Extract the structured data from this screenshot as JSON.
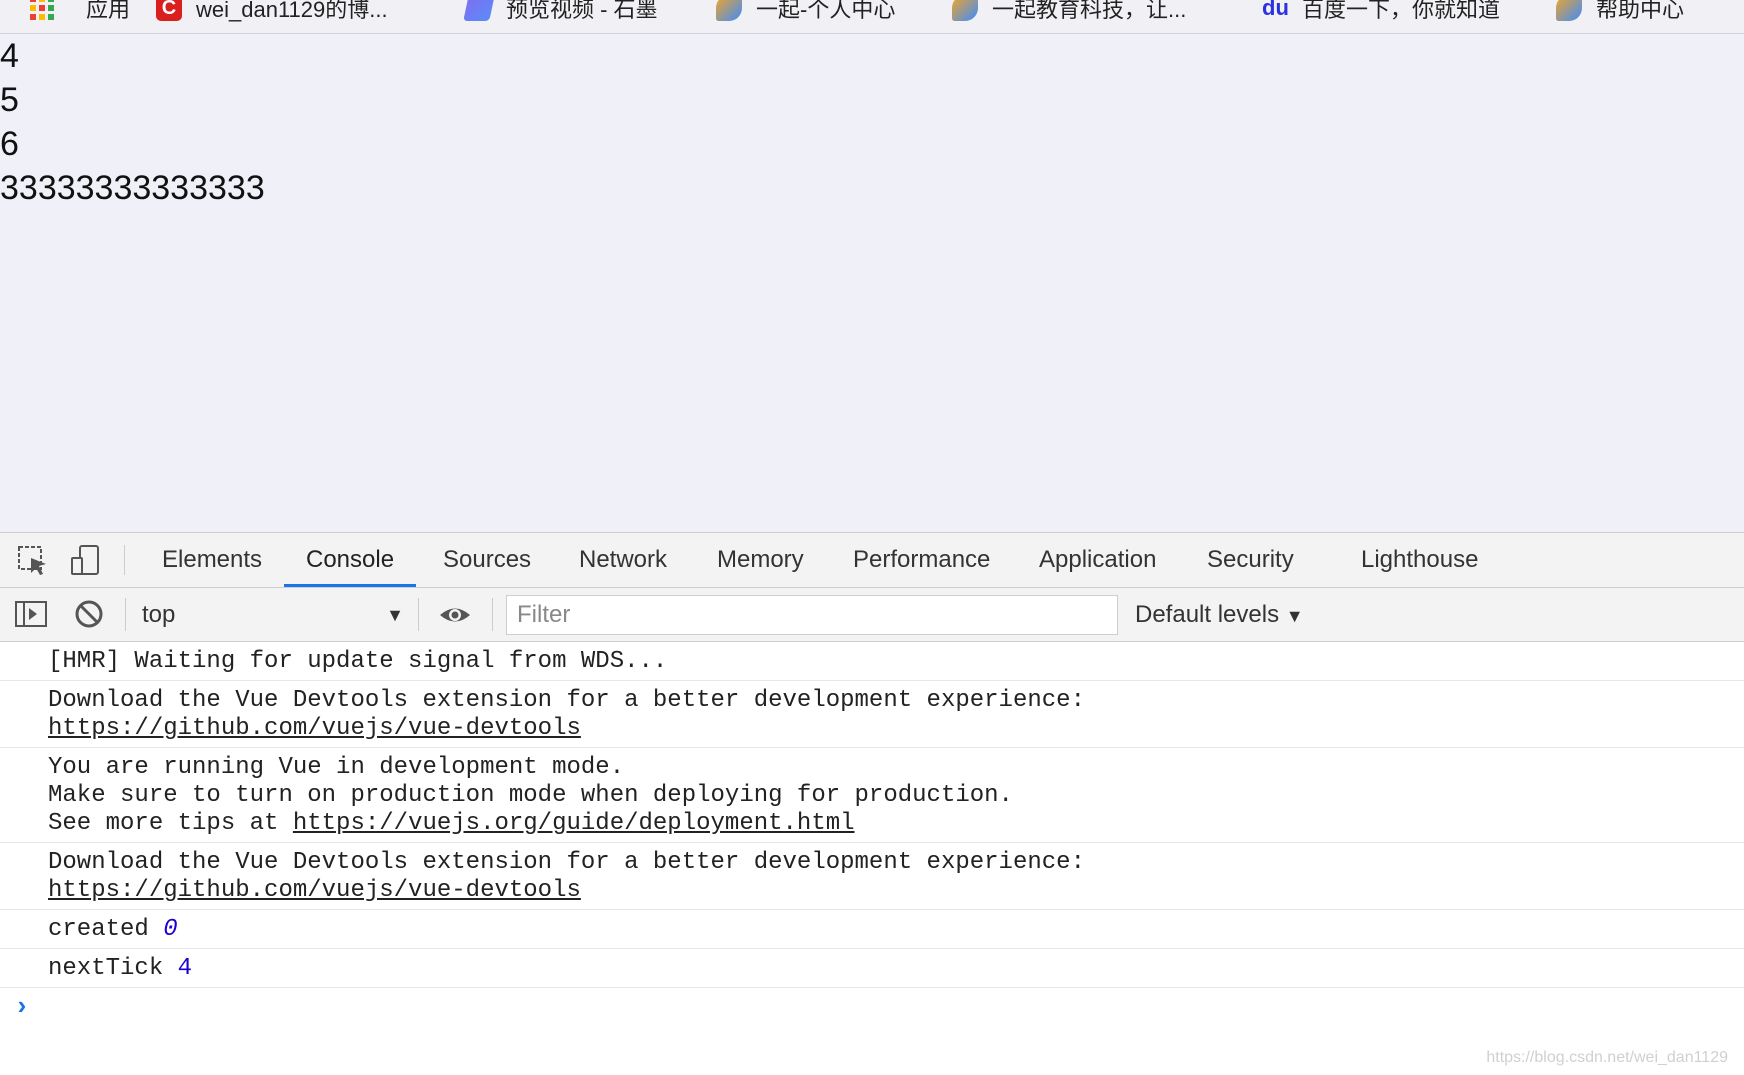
{
  "bookmarks": [
    {
      "label": "应用",
      "icon": "apps-grid-icon"
    },
    {
      "label": "wei_dan1129的博...",
      "icon": "csdn-icon"
    },
    {
      "label": "预览视频 - 石墨",
      "icon": "shimo-icon"
    },
    {
      "label": "一起-个人中心",
      "icon": "yiqi-icon"
    },
    {
      "label": "一起教育科技，让...",
      "icon": "yiqi-icon"
    },
    {
      "label": "百度一下，你就知道",
      "icon": "baidu-icon"
    },
    {
      "label": "帮助中心",
      "icon": "yiqi-icon"
    }
  ],
  "page_lines": [
    "4",
    "5",
    "6",
    "33333333333333"
  ],
  "devtools": {
    "tabs": [
      "Elements",
      "Console",
      "Sources",
      "Network",
      "Memory",
      "Performance",
      "Application",
      "Security",
      "Lighthouse"
    ],
    "active_tab": "Console",
    "context": "top",
    "filter_placeholder": "Filter",
    "levels": "Default levels",
    "messages": {
      "m1": "[HMR] Waiting for update signal from WDS...",
      "m2_text": "Download the Vue Devtools extension for a better development experience:",
      "m2_link": "https://github.com/vuejs/vue-devtools",
      "m3_l1": "You are running Vue in development mode.",
      "m3_l2": "Make sure to turn on production mode when deploying for production.",
      "m3_l3_prefix": "See more tips at ",
      "m3_l3_link": "https://vuejs.org/guide/deployment.html",
      "m4_text": "Download the Vue Devtools extension for a better development experience:",
      "m4_link": "https://github.com/vuejs/vue-devtools",
      "m5_label": "created",
      "m5_value": "0",
      "m6_label": "nextTick",
      "m6_value": "4"
    },
    "prompt": "›"
  },
  "watermark": "https://blog.csdn.net/wei_dan1129",
  "colors": {
    "accent": "#1a73e8",
    "number": "#1c00cf",
    "page_bg": "#f0f0f8"
  }
}
